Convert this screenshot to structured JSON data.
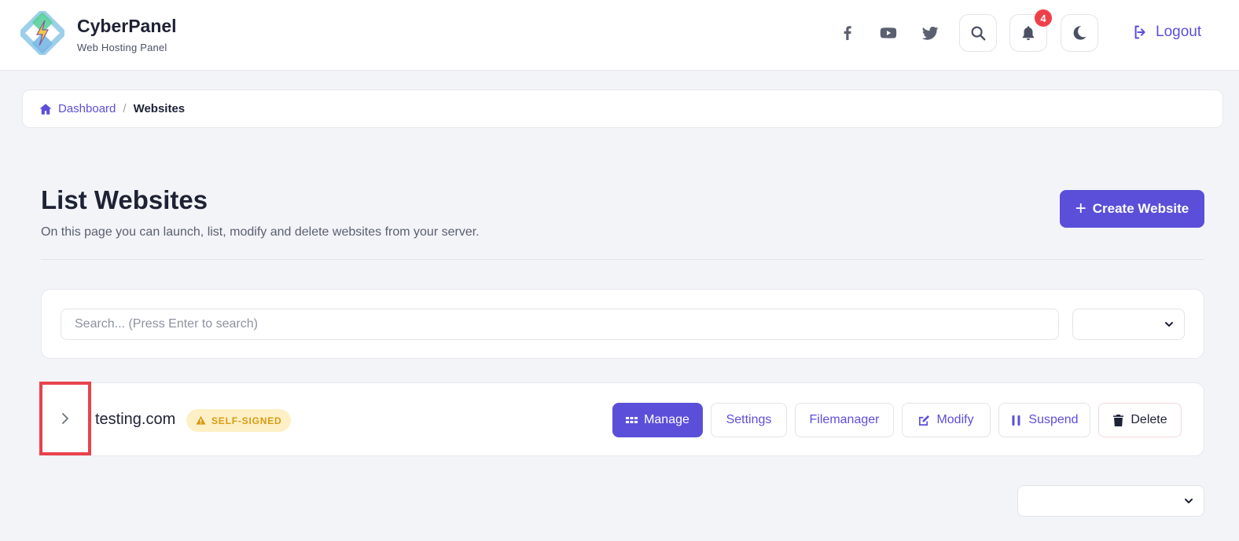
{
  "brand": {
    "name": "CyberPanel",
    "subtitle": "Web Hosting Panel"
  },
  "header": {
    "social": [
      "facebook-icon",
      "youtube-icon",
      "twitter-icon"
    ],
    "notifications_count": "4",
    "logout_label": "Logout"
  },
  "breadcrumb": {
    "home": "Dashboard",
    "separator": "/",
    "current": "Websites"
  },
  "page": {
    "title": "List Websites",
    "description": "On this page you can launch, list, modify and delete websites from your server.",
    "create_label": "Create Website"
  },
  "search": {
    "placeholder": "Search... (Press Enter to search)",
    "value": "",
    "filter_value": ""
  },
  "websites": [
    {
      "domain": "testing.com",
      "ssl_status": "SELF-SIGNED",
      "actions": {
        "manage": "Manage",
        "settings": "Settings",
        "filemanager": "Filemanager",
        "modify": "Modify",
        "suspend": "Suspend",
        "delete": "Delete"
      }
    }
  ],
  "pagination": {
    "page_size_value": ""
  },
  "colors": {
    "accent": "#5b4fd9",
    "badge_red": "#ef3f4a",
    "warning": "#d89a12",
    "warning_bg": "#fdf0c6",
    "highlight": "#e9424c"
  }
}
